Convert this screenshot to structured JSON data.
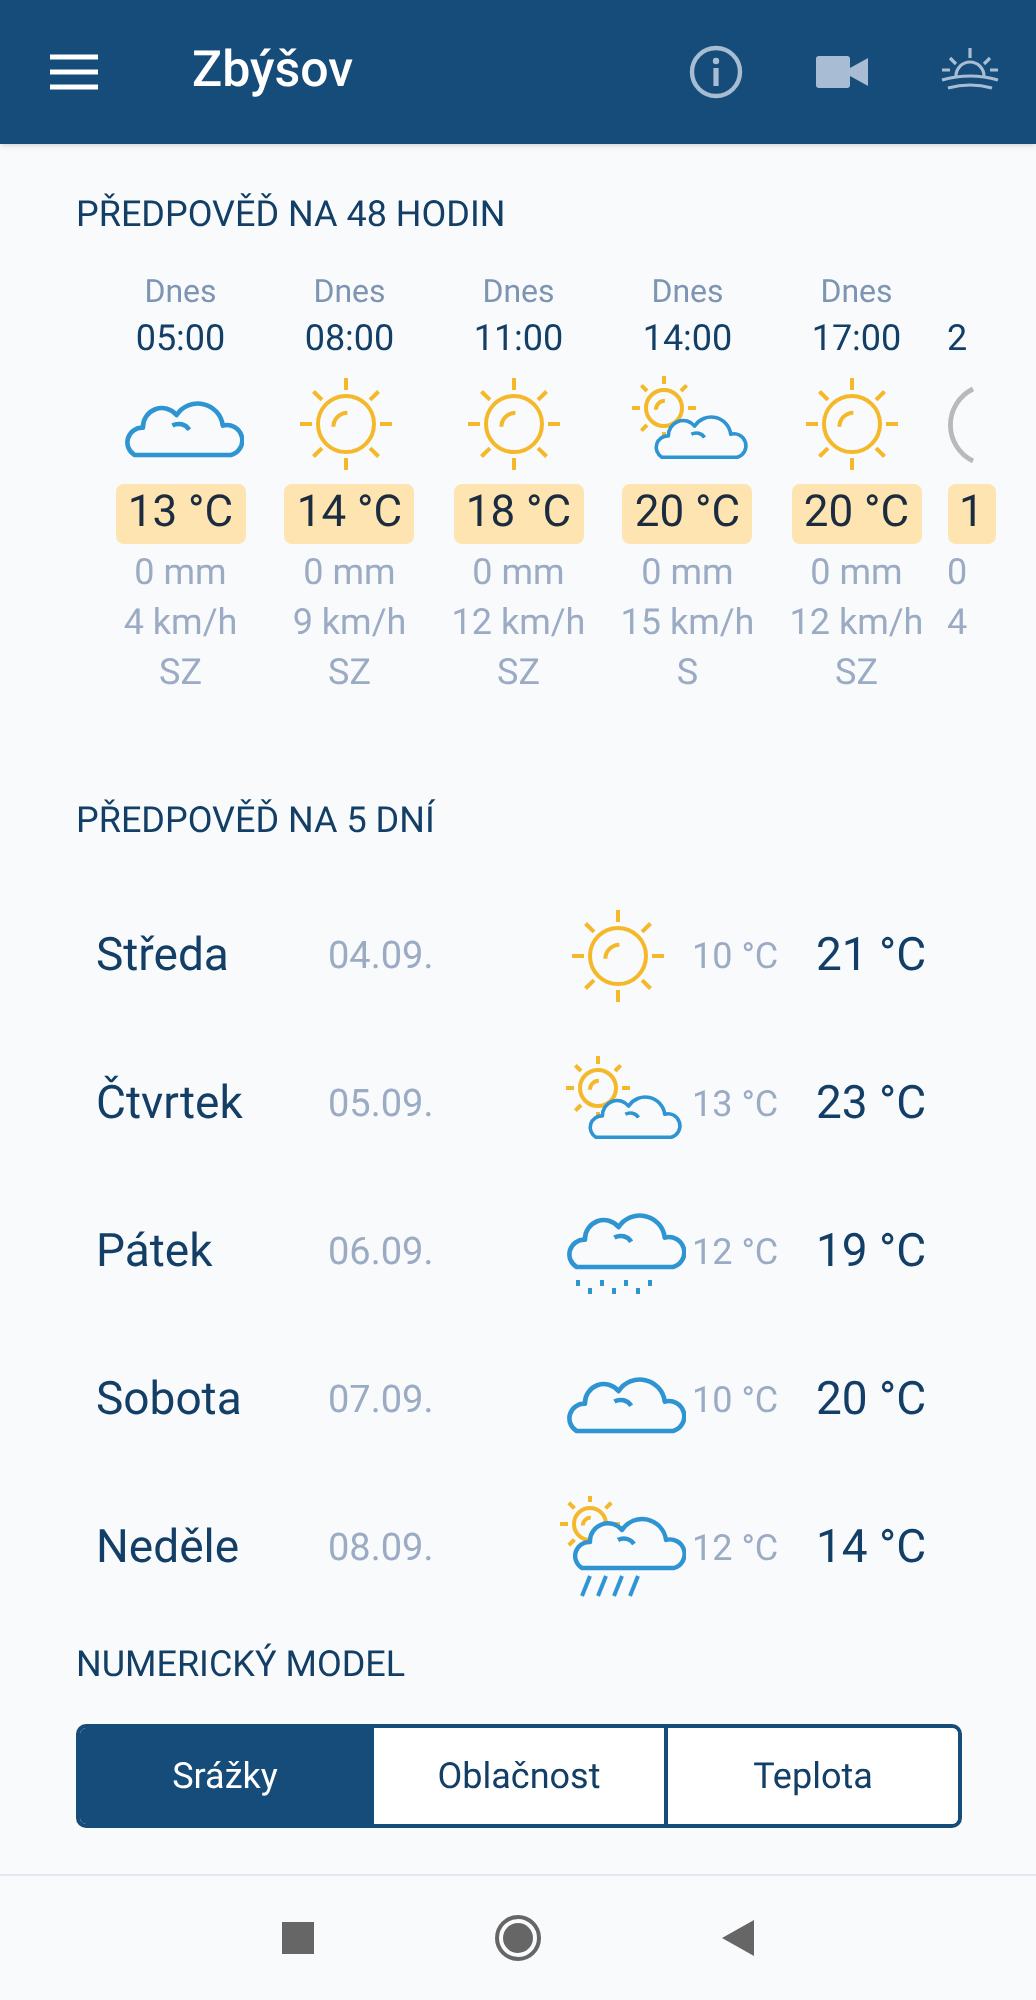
{
  "app_bar": {
    "title": "Zbýšov"
  },
  "hourly": {
    "title": "PŘEDPOVĚĎ NA 48 HODIN",
    "items": [
      {
        "day": "Dnes",
        "time": "05:00",
        "kind": "cloud",
        "temp": "13 °C",
        "rain": "0 mm",
        "wind": "4 km/h",
        "dir": "SZ"
      },
      {
        "day": "Dnes",
        "time": "08:00",
        "kind": "sun",
        "temp": "14 °C",
        "rain": "0 mm",
        "wind": "9 km/h",
        "dir": "SZ"
      },
      {
        "day": "Dnes",
        "time": "11:00",
        "kind": "sun",
        "temp": "18 °C",
        "rain": "0 mm",
        "wind": "12 km/h",
        "dir": "SZ"
      },
      {
        "day": "Dnes",
        "time": "14:00",
        "kind": "sun-cloud",
        "temp": "20 °C",
        "rain": "0 mm",
        "wind": "15 km/h",
        "dir": "S"
      },
      {
        "day": "Dnes",
        "time": "17:00",
        "kind": "sun",
        "temp": "20 °C",
        "rain": "0 mm",
        "wind": "12 km/h",
        "dir": "SZ"
      },
      {
        "time": "2",
        "kind": "moon",
        "temp": "1",
        "rain": "0",
        "wind": "4"
      }
    ]
  },
  "daily": {
    "title": "PŘEDPOVĚĎ NA 5 DNÍ",
    "items": [
      {
        "day": "Středa",
        "date": "04.09.",
        "kind": "sun",
        "low": "10 °C",
        "high": "21 °C"
      },
      {
        "day": "Čtvrtek",
        "date": "05.09.",
        "kind": "sun-cloud",
        "low": "13 °C",
        "high": "23 °C"
      },
      {
        "day": "Pátek",
        "date": "06.09.",
        "kind": "drizzle",
        "low": "12 °C",
        "high": "19 °C"
      },
      {
        "day": "Sobota",
        "date": "07.09.",
        "kind": "cloud",
        "low": "10 °C",
        "high": "20 °C"
      },
      {
        "day": "Neděle",
        "date": "08.09.",
        "kind": "sun-rain",
        "low": "12 °C",
        "high": "14 °C"
      }
    ]
  },
  "model": {
    "title": "NUMERICKÝ MODEL",
    "tabs": [
      {
        "label": "Srážky",
        "selected": true
      },
      {
        "label": "Oblačnost",
        "selected": false
      },
      {
        "label": "Teplota",
        "selected": false
      }
    ]
  }
}
